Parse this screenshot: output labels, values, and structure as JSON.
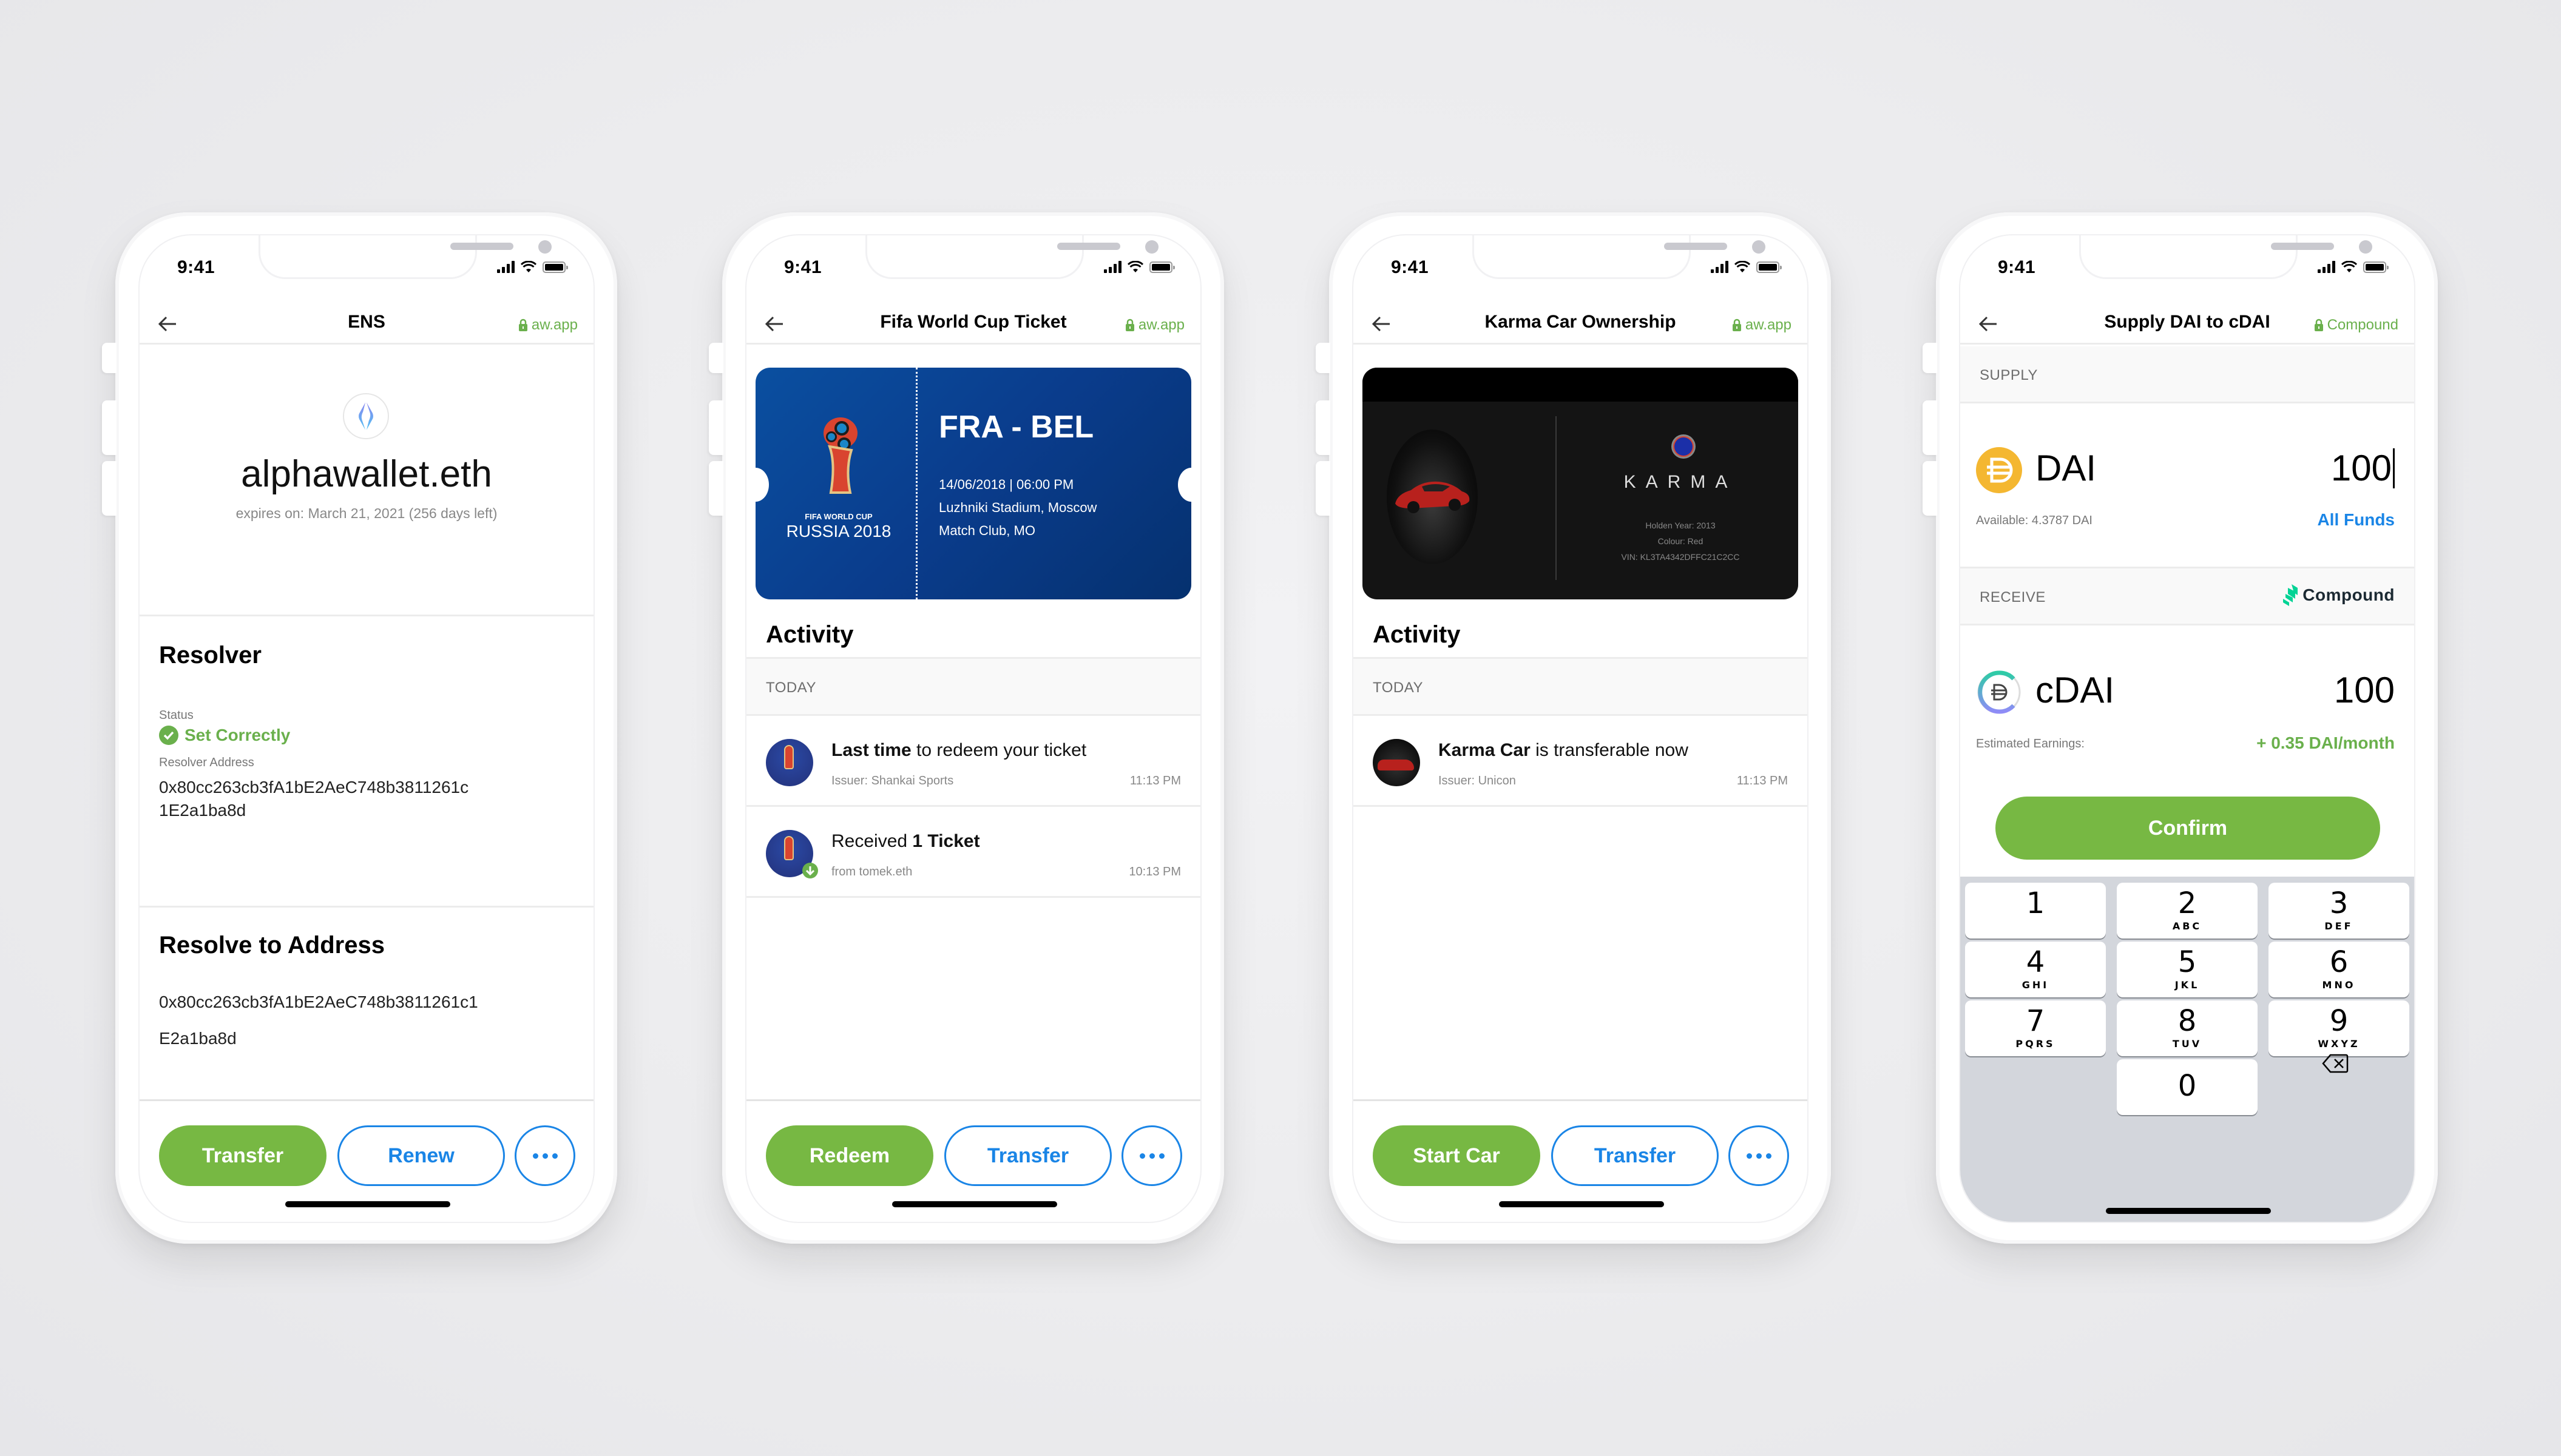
{
  "status_bar": {
    "time": "9:41"
  },
  "phones": [
    {
      "nav": {
        "title": "ENS",
        "origin": "aw.app"
      },
      "ens": {
        "name": "alphawallet.eth",
        "expires": "expires on: March 21, 2021 (256 days left)",
        "resolver": {
          "heading": "Resolver",
          "status_label": "Status",
          "status_value": "Set Correctly",
          "address_label": "Resolver Address",
          "address_line1": "0x80cc263cb3fA1bE2AeC748b3811261c",
          "address_line2": "1E2a1ba8d"
        },
        "resolve_to": {
          "heading": "Resolve to Address",
          "address_line1": "0x80cc263cb3fA1bE2AeC748b3811261c1",
          "address_line2": "E2a1ba8d"
        }
      },
      "buttons": {
        "primary": "Transfer",
        "secondary": "Renew"
      }
    },
    {
      "nav": {
        "title": "Fifa World Cup Ticket",
        "origin": "aw.app"
      },
      "ticket": {
        "logo_line1": "FIFA WORLD CUP",
        "logo_line2": "RUSSIA 2018",
        "match": "FRA - BEL",
        "datetime": "14/06/2018 | 06:00 PM",
        "venue": "Luzhniki Stadium, Moscow",
        "club": "Match Club, MO"
      },
      "activity": {
        "heading": "Activity",
        "group": "TODAY",
        "items": [
          {
            "title_bold": "Last time",
            "title_rest": " to redeem your ticket",
            "sub": "Issuer: Shankai Sports",
            "time": "11:13 PM"
          },
          {
            "title_rest_pre": "Received ",
            "title_bold": "1 Ticket",
            "sub": "from tomek.eth",
            "time": "10:13 PM"
          }
        ]
      },
      "buttons": {
        "primary": "Redeem",
        "secondary": "Transfer"
      }
    },
    {
      "nav": {
        "title": "Karma Car Ownership",
        "origin": "aw.app"
      },
      "car": {
        "brand": "KARMA",
        "year": "Holden Year: 2013",
        "colour": "Colour: Red",
        "vin": "VIN: KL3TA4342DFFC21C2CC"
      },
      "activity": {
        "heading": "Activity",
        "group": "TODAY",
        "items": [
          {
            "title_bold": "Karma Car",
            "title_rest": " is transferable now",
            "sub": "Issuer: Unicon",
            "time": "11:13 PM"
          }
        ]
      },
      "buttons": {
        "primary": "Start Car",
        "secondary": "Transfer"
      }
    },
    {
      "nav": {
        "title": "Supply DAI to cDAI",
        "origin": "Compound"
      },
      "supply": {
        "section": "SUPPLY",
        "token": "DAI",
        "amount": "100",
        "available": "Available: 4.3787 DAI",
        "all_funds": "All Funds"
      },
      "receive": {
        "section": "RECEIVE",
        "brand": "Compound",
        "token": "cDAI",
        "amount": "100",
        "earnings_label": "Estimated Earnings:",
        "earnings_value": "+ 0.35 DAI/month"
      },
      "confirm": "Confirm",
      "keypad": [
        {
          "n": "1",
          "l": ""
        },
        {
          "n": "2",
          "l": "ABC"
        },
        {
          "n": "3",
          "l": "DEF"
        },
        {
          "n": "4",
          "l": "GHI"
        },
        {
          "n": "5",
          "l": "JKL"
        },
        {
          "n": "6",
          "l": "MNO"
        },
        {
          "n": "7",
          "l": "PQRS"
        },
        {
          "n": "8",
          "l": "TUV"
        },
        {
          "n": "9",
          "l": "WXYZ"
        },
        {
          "n": "0",
          "l": ""
        }
      ]
    }
  ],
  "colors": {
    "green": "#77b843",
    "blue": "#1a85e6",
    "dai": "#f4b731",
    "compound": "#00d395"
  }
}
